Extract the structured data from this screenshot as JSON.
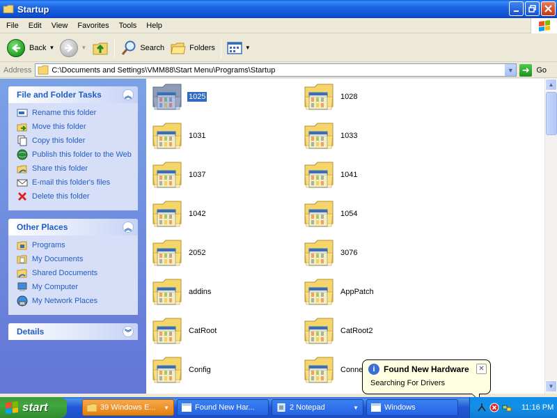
{
  "window": {
    "title": "Startup"
  },
  "menu": [
    "File",
    "Edit",
    "View",
    "Favorites",
    "Tools",
    "Help"
  ],
  "toolbar": {
    "back": "Back",
    "search": "Search",
    "folders": "Folders"
  },
  "address": {
    "label": "Address",
    "path": "C:\\Documents and Settings\\VMM88\\Start Menu\\Programs\\Startup",
    "go": "Go"
  },
  "tasks": {
    "file_folder": {
      "title": "File and Folder Tasks",
      "items": [
        "Rename this folder",
        "Move this folder",
        "Copy this folder",
        "Publish this folder to the Web",
        "Share this folder",
        "E-mail this folder's files",
        "Delete this folder"
      ]
    },
    "other_places": {
      "title": "Other Places",
      "items": [
        "Programs",
        "My Documents",
        "Shared Documents",
        "My Computer",
        "My Network Places"
      ]
    },
    "details": {
      "title": "Details"
    }
  },
  "folders": [
    "1025",
    "1028",
    "1031",
    "1033",
    "1037",
    "1041",
    "1042",
    "1054",
    "2052",
    "3076",
    "addins",
    "AppPatch",
    "CatRoot",
    "CatRoot2",
    "Config",
    "Conne"
  ],
  "selected_folder": "1025",
  "balloon": {
    "title": "Found New Hardware",
    "body": "Searching For Drivers"
  },
  "taskbar": {
    "start": "start",
    "buttons": [
      "39 Windows E...",
      "Found New Har...",
      "2 Notepad",
      "Windows"
    ],
    "clock": "11:16 PM"
  },
  "colors": {
    "title_blue": "#0d4fd1",
    "task_link": "#215dc6",
    "selection": "#316ac5",
    "start_green": "#3ea83e",
    "taskbar_blue": "#2157d7"
  }
}
